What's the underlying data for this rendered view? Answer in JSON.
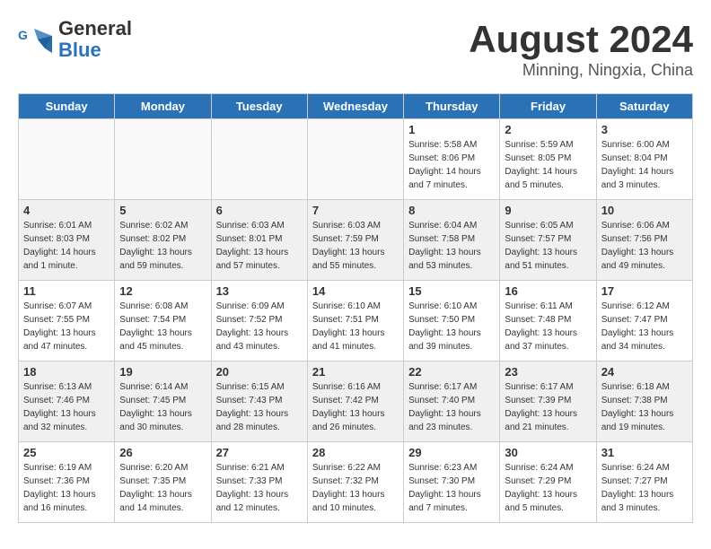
{
  "logo": {
    "line1": "General",
    "line2": "Blue"
  },
  "title": "August 2024",
  "subtitle": "Minning, Ningxia, China",
  "days": [
    "Sunday",
    "Monday",
    "Tuesday",
    "Wednesday",
    "Thursday",
    "Friday",
    "Saturday"
  ],
  "weeks": [
    [
      {
        "day": "",
        "info": ""
      },
      {
        "day": "",
        "info": ""
      },
      {
        "day": "",
        "info": ""
      },
      {
        "day": "",
        "info": ""
      },
      {
        "day": "1",
        "info": "Sunrise: 5:58 AM\nSunset: 8:06 PM\nDaylight: 14 hours\nand 7 minutes."
      },
      {
        "day": "2",
        "info": "Sunrise: 5:59 AM\nSunset: 8:05 PM\nDaylight: 14 hours\nand 5 minutes."
      },
      {
        "day": "3",
        "info": "Sunrise: 6:00 AM\nSunset: 8:04 PM\nDaylight: 14 hours\nand 3 minutes."
      }
    ],
    [
      {
        "day": "4",
        "info": "Sunrise: 6:01 AM\nSunset: 8:03 PM\nDaylight: 14 hours\nand 1 minute."
      },
      {
        "day": "5",
        "info": "Sunrise: 6:02 AM\nSunset: 8:02 PM\nDaylight: 13 hours\nand 59 minutes."
      },
      {
        "day": "6",
        "info": "Sunrise: 6:03 AM\nSunset: 8:01 PM\nDaylight: 13 hours\nand 57 minutes."
      },
      {
        "day": "7",
        "info": "Sunrise: 6:03 AM\nSunset: 7:59 PM\nDaylight: 13 hours\nand 55 minutes."
      },
      {
        "day": "8",
        "info": "Sunrise: 6:04 AM\nSunset: 7:58 PM\nDaylight: 13 hours\nand 53 minutes."
      },
      {
        "day": "9",
        "info": "Sunrise: 6:05 AM\nSunset: 7:57 PM\nDaylight: 13 hours\nand 51 minutes."
      },
      {
        "day": "10",
        "info": "Sunrise: 6:06 AM\nSunset: 7:56 PM\nDaylight: 13 hours\nand 49 minutes."
      }
    ],
    [
      {
        "day": "11",
        "info": "Sunrise: 6:07 AM\nSunset: 7:55 PM\nDaylight: 13 hours\nand 47 minutes."
      },
      {
        "day": "12",
        "info": "Sunrise: 6:08 AM\nSunset: 7:54 PM\nDaylight: 13 hours\nand 45 minutes."
      },
      {
        "day": "13",
        "info": "Sunrise: 6:09 AM\nSunset: 7:52 PM\nDaylight: 13 hours\nand 43 minutes."
      },
      {
        "day": "14",
        "info": "Sunrise: 6:10 AM\nSunset: 7:51 PM\nDaylight: 13 hours\nand 41 minutes."
      },
      {
        "day": "15",
        "info": "Sunrise: 6:10 AM\nSunset: 7:50 PM\nDaylight: 13 hours\nand 39 minutes."
      },
      {
        "day": "16",
        "info": "Sunrise: 6:11 AM\nSunset: 7:48 PM\nDaylight: 13 hours\nand 37 minutes."
      },
      {
        "day": "17",
        "info": "Sunrise: 6:12 AM\nSunset: 7:47 PM\nDaylight: 13 hours\nand 34 minutes."
      }
    ],
    [
      {
        "day": "18",
        "info": "Sunrise: 6:13 AM\nSunset: 7:46 PM\nDaylight: 13 hours\nand 32 minutes."
      },
      {
        "day": "19",
        "info": "Sunrise: 6:14 AM\nSunset: 7:45 PM\nDaylight: 13 hours\nand 30 minutes."
      },
      {
        "day": "20",
        "info": "Sunrise: 6:15 AM\nSunset: 7:43 PM\nDaylight: 13 hours\nand 28 minutes."
      },
      {
        "day": "21",
        "info": "Sunrise: 6:16 AM\nSunset: 7:42 PM\nDaylight: 13 hours\nand 26 minutes."
      },
      {
        "day": "22",
        "info": "Sunrise: 6:17 AM\nSunset: 7:40 PM\nDaylight: 13 hours\nand 23 minutes."
      },
      {
        "day": "23",
        "info": "Sunrise: 6:17 AM\nSunset: 7:39 PM\nDaylight: 13 hours\nand 21 minutes."
      },
      {
        "day": "24",
        "info": "Sunrise: 6:18 AM\nSunset: 7:38 PM\nDaylight: 13 hours\nand 19 minutes."
      }
    ],
    [
      {
        "day": "25",
        "info": "Sunrise: 6:19 AM\nSunset: 7:36 PM\nDaylight: 13 hours\nand 16 minutes."
      },
      {
        "day": "26",
        "info": "Sunrise: 6:20 AM\nSunset: 7:35 PM\nDaylight: 13 hours\nand 14 minutes."
      },
      {
        "day": "27",
        "info": "Sunrise: 6:21 AM\nSunset: 7:33 PM\nDaylight: 13 hours\nand 12 minutes."
      },
      {
        "day": "28",
        "info": "Sunrise: 6:22 AM\nSunset: 7:32 PM\nDaylight: 13 hours\nand 10 minutes."
      },
      {
        "day": "29",
        "info": "Sunrise: 6:23 AM\nSunset: 7:30 PM\nDaylight: 13 hours\nand 7 minutes."
      },
      {
        "day": "30",
        "info": "Sunrise: 6:24 AM\nSunset: 7:29 PM\nDaylight: 13 hours\nand 5 minutes."
      },
      {
        "day": "31",
        "info": "Sunrise: 6:24 AM\nSunset: 7:27 PM\nDaylight: 13 hours\nand 3 minutes."
      }
    ]
  ]
}
